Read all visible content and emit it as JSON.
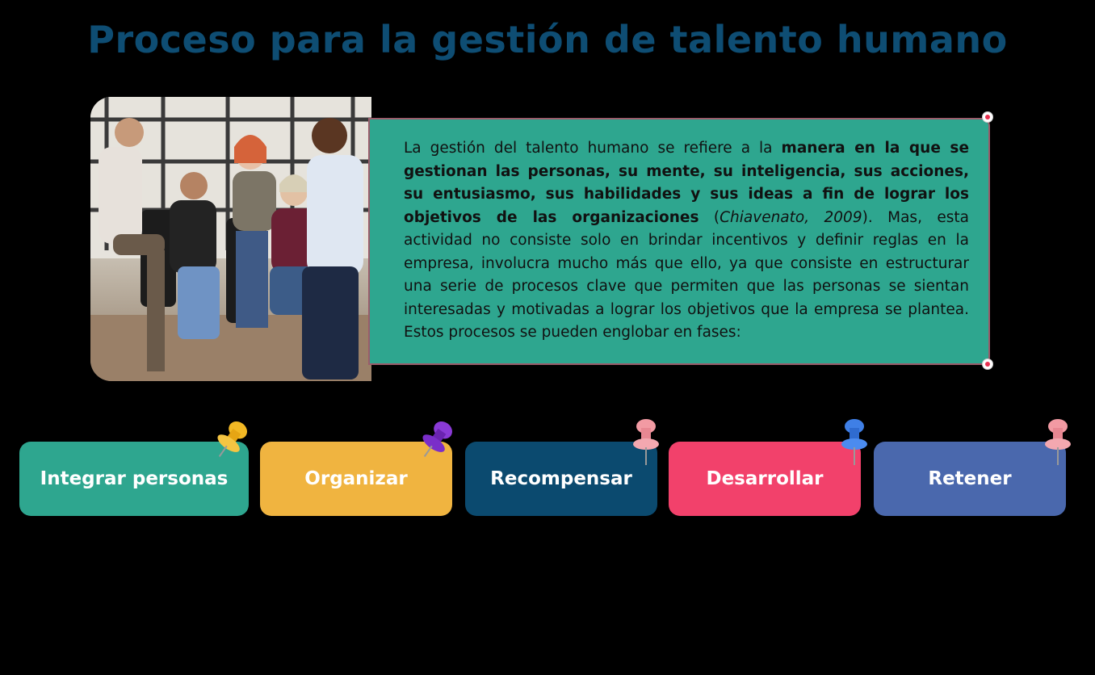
{
  "title": "Proceso para la gestión de talento humano",
  "description": {
    "p1": "La gestión del talento humano se refiere a la ",
    "b1": "manera en la que se gestionan las personas, su mente, su inteligencia, sus acciones, su entusiasmo, sus habilidades y sus ideas a fin de lograr los objetivos de las organizaciones",
    "p2": " (",
    "cite": "Chiavenato, 2009",
    "p3": "). Mas, esta actividad no consiste solo en brindar incentivos y definir reglas en la empresa, involucra mucho más que ello, ya que consiste en estructurar una serie de procesos clave que permiten que las personas se sientan interesadas y motivadas a lograr los objetivos que la empresa se plantea. Estos procesos se pueden englobar en fases:"
  },
  "phases": [
    {
      "label": "Integrar personas",
      "color": "#2ea68f",
      "pin_color": "#f2b824",
      "pin_icon": "pushpin-icon"
    },
    {
      "label": "Organizar",
      "color": "#f0b440",
      "pin_color": "#7a2ec9",
      "pin_icon": "pushpin-icon"
    },
    {
      "label": "Recompensar",
      "color": "#0b4a6f",
      "pin_color": "#f29aa3",
      "pin_icon": "pushpin-icon"
    },
    {
      "label": "Desarrollar",
      "color": "#f2416b",
      "pin_color": "#3f7fe6",
      "pin_icon": "pushpin-icon"
    },
    {
      "label": "Retener",
      "color": "#4a68ad",
      "pin_color": "#f29aa3",
      "pin_icon": "pushpin-icon"
    }
  ]
}
